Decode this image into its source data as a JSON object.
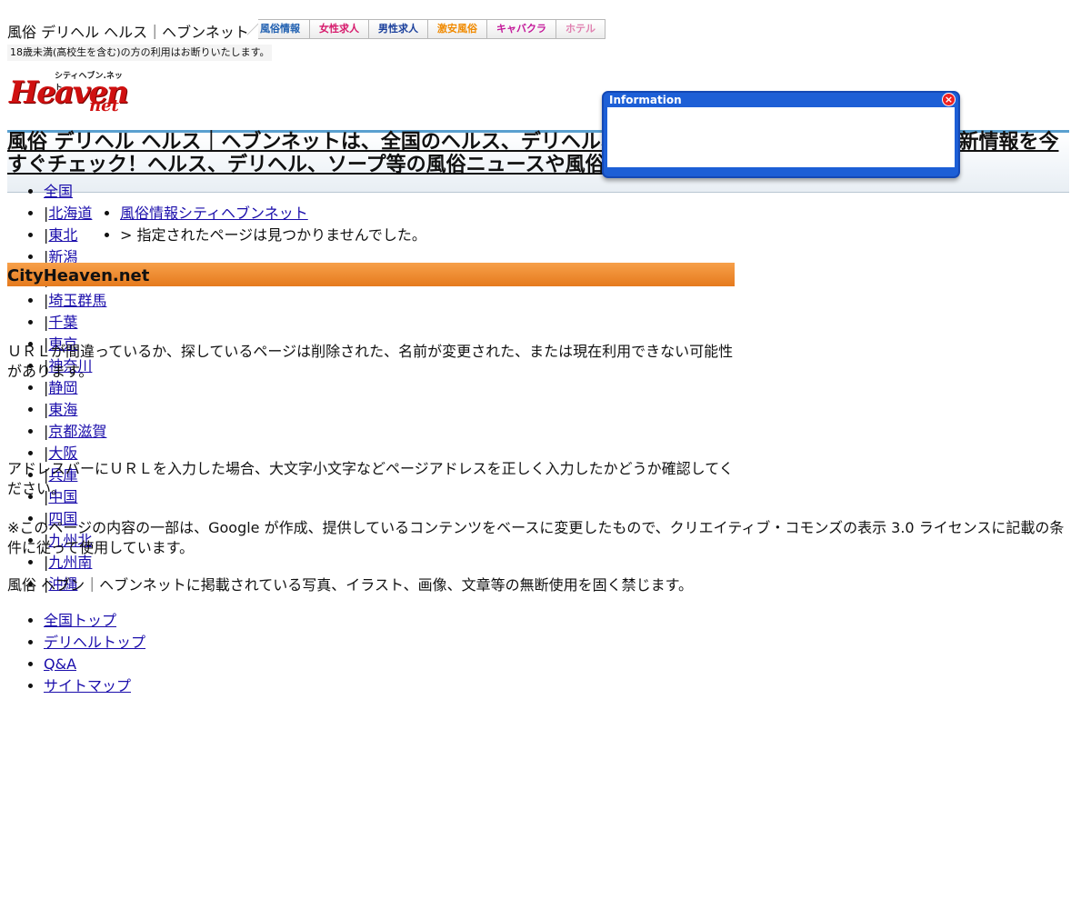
{
  "header": {
    "site_title": "風俗 デリヘル ヘルス｜ヘブンネット",
    "tabs": [
      {
        "label": "風俗情報",
        "color": "#1f5fb0"
      },
      {
        "label": "女性求人",
        "color": "#d6196b"
      },
      {
        "label": "男性求人",
        "color": "#1a3f9c"
      },
      {
        "label": "激安風俗",
        "color": "#f08a00"
      },
      {
        "label": "キャバクラ",
        "color": "#c4189a"
      },
      {
        "label": "ホテル",
        "color": "#e080b0"
      }
    ],
    "age_notice": "18歳未満(高校生を含む)の方の利用はお断りいたします。",
    "logo": {
      "kana": "シティヘブン.ネット",
      "main": "Heaven",
      "city": "City",
      "net": "net"
    }
  },
  "headline": "風俗 デリヘル ヘルス｜ヘブンネットは、全国のヘルス、デリヘル、ソープ等の風俗ニュースや風俗嬢の最新情報を今すぐチェック！ヘルス、デリヘル、ソープ等の風俗ニュースや風俗嬢の最新情報を今すぐチェック！",
  "info_popup": {
    "title": "Information",
    "close": "×"
  },
  "regions": [
    {
      "sep": "",
      "label": "全国"
    },
    {
      "sep": "|",
      "label": "北海道"
    },
    {
      "sep": "|",
      "label": "東北"
    },
    {
      "sep": "|",
      "label": "新潟"
    },
    {
      "sep": "|",
      "label": "北陸"
    },
    {
      "sep": "|",
      "label": "埼玉群馬"
    },
    {
      "sep": "|",
      "label": "千葉"
    },
    {
      "sep": "|",
      "label": "東京"
    },
    {
      "sep": "|",
      "label": "神奈川"
    },
    {
      "sep": "|",
      "label": "静岡"
    },
    {
      "sep": "|",
      "label": "東海"
    },
    {
      "sep": "|",
      "label": "京都滋賀"
    },
    {
      "sep": "|",
      "label": "大阪"
    },
    {
      "sep": "|",
      "label": "兵庫"
    },
    {
      "sep": "|",
      "label": "中国"
    },
    {
      "sep": "|",
      "label": "四国"
    },
    {
      "sep": "|",
      "label": "九州北"
    },
    {
      "sep": "|",
      "label": "九州南"
    },
    {
      "sep": "|",
      "label": "沖縄"
    }
  ],
  "breadcrumb": {
    "home_link": "風俗情報シティヘブンネット",
    "current": "> 指定されたページは見つかりませんでした。"
  },
  "section_title": "CityHeaven.net",
  "messages": {
    "not_found": "ＵＲＬが間違っているか、探しているページは削除された、名前が変更された、または現在利用できない可能性があります。",
    "check_url": "アドレスバーにＵＲＬを入力した場合、大文字小文字などページアドレスを正しく入力したかどうか確認してください。",
    "license": "※このページの内容の一部は、Google が作成、提供しているコンテンツをベースに変更したもので、クリエイティブ・コモンズの表示 3.0 ライセンスに記載の条件に従って使用しています。"
  },
  "copyright": "風俗 ヘブン｜ヘブンネットに掲載されている写真、イラスト、画像、文章等の無断使用を固く禁じます。",
  "footer_links": [
    "全国トップ",
    "デリヘルトップ",
    "Q&A",
    "サイトマップ"
  ]
}
